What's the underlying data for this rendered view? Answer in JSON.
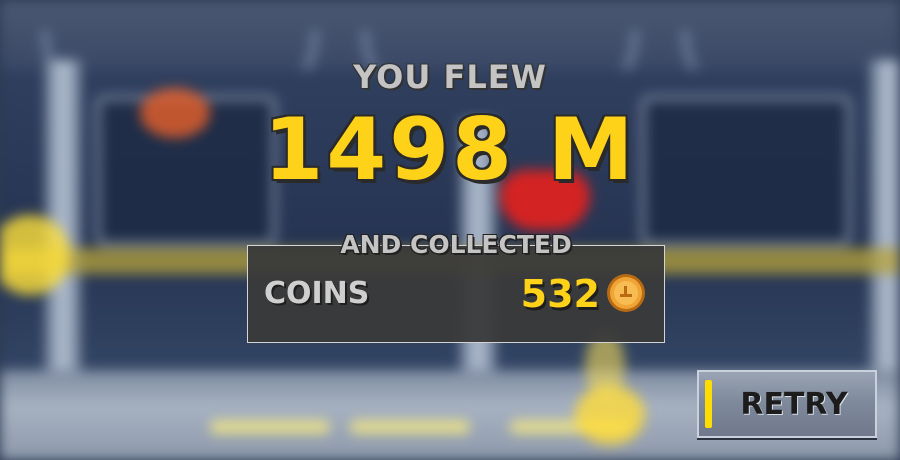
{
  "result": {
    "heading": "YOU FLEW",
    "distance": "1498 M"
  },
  "collected": {
    "heading": "AND COLLECTED",
    "item_label": "COINS",
    "item_value": "532",
    "item_icon": "coin-icon"
  },
  "actions": {
    "retry_label": "RETRY"
  },
  "colors": {
    "accent_yellow": "#ffd21a",
    "panel": "#3a3a3a",
    "label_grey": "#c4c4c4",
    "button": "#7f8a9c"
  }
}
